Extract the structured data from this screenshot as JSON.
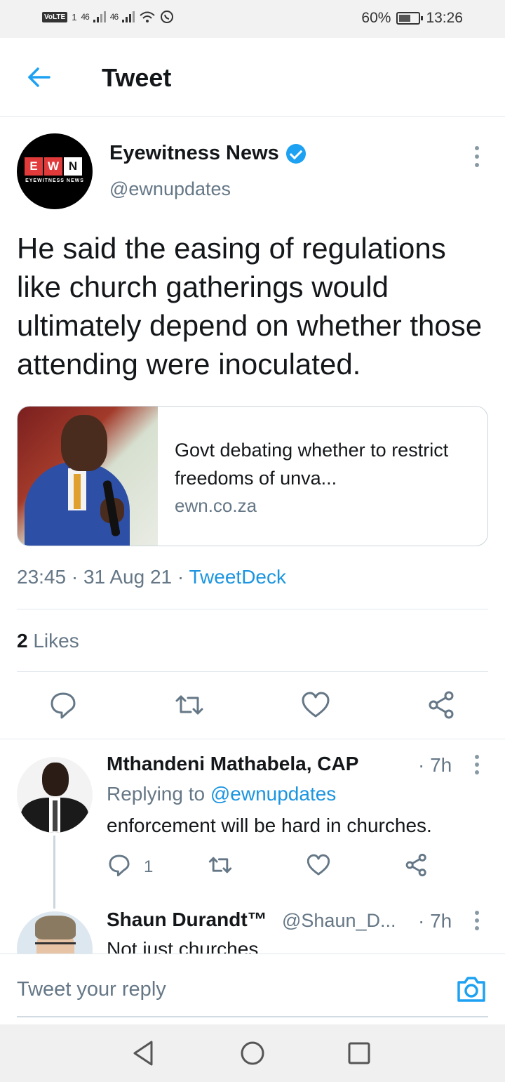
{
  "status_bar": {
    "left_label": "VoLTE",
    "sim_badge": "1",
    "signal_1": "46",
    "signal_2": "46",
    "battery_percent": "60%",
    "battery_level": 0.6,
    "time": "13:26"
  },
  "header": {
    "back_icon": "arrow-left-icon",
    "title": "Tweet"
  },
  "tweet": {
    "author_name": "Eyewitness News",
    "author_handle": "@ewnupdates",
    "verified": true,
    "avatar_logo": {
      "letters": [
        "E",
        "W",
        "N"
      ],
      "subtitle": "EYEWITNESS NEWS"
    },
    "text": "He said the easing of regulations like church gatherings would ultimately depend on whether those attending were inoculated.",
    "card": {
      "title": "Govt debating whether to restrict freedoms of unva...",
      "domain": "ewn.co.za"
    },
    "time": "23:45",
    "date": "31 Aug 21",
    "source": "TweetDeck",
    "likes_count": "2",
    "likes_label": "Likes"
  },
  "replies": [
    {
      "name": "Mthandeni Mathabela, CAP",
      "time": "· 7h",
      "replying_prefix": "Replying to",
      "replying_to": "@ewnupdates",
      "text": "enforcement will be hard in churches.",
      "reply_count": "1"
    },
    {
      "name": "Shaun Durandt™",
      "handle": "@Shaun_D...",
      "time": "· 7h",
      "text": "Not just churches"
    }
  ],
  "composer": {
    "placeholder": "Tweet your reply",
    "camera_icon": "camera-icon"
  },
  "colors": {
    "accent": "#1da1f2",
    "link": "#1b95e0",
    "secondary_text": "#657786",
    "primary_text": "#14171a"
  }
}
